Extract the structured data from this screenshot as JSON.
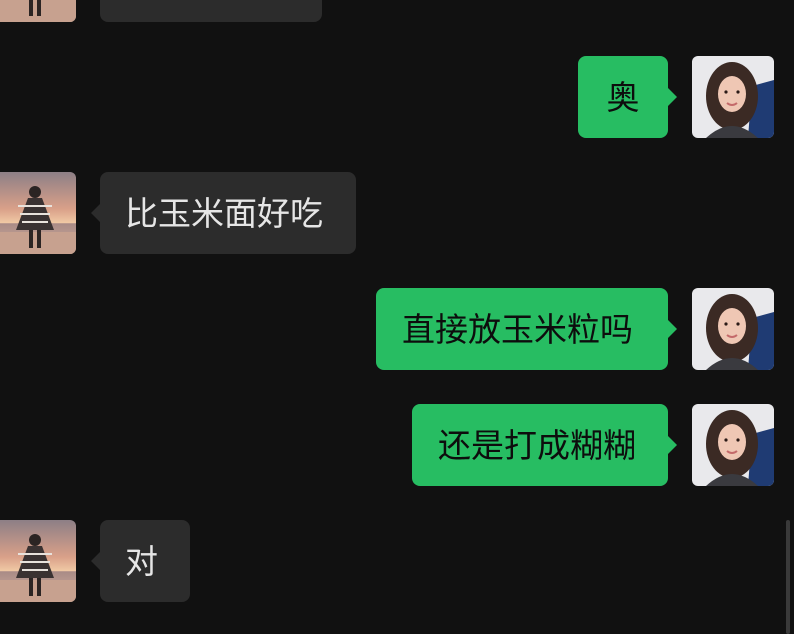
{
  "colors": {
    "background": "#111111",
    "incoming_bubble": "#2c2c2c",
    "outgoing_bubble": "#27bd62",
    "incoming_text": "#e6e6e6",
    "outgoing_text": "#0d0d0d"
  },
  "messages": [
    {
      "side": "incoming",
      "text": "",
      "avatar": "contact-avatar-icon"
    },
    {
      "side": "outgoing",
      "text": "奥",
      "avatar": "user-avatar-icon"
    },
    {
      "side": "incoming",
      "text": "比玉米面好吃",
      "avatar": "contact-avatar-icon"
    },
    {
      "side": "outgoing",
      "text": "直接放玉米粒吗",
      "avatar": "user-avatar-icon"
    },
    {
      "side": "outgoing",
      "text": "还是打成糊糊",
      "avatar": "user-avatar-icon"
    },
    {
      "side": "incoming",
      "text": "对",
      "avatar": "contact-avatar-icon"
    }
  ]
}
